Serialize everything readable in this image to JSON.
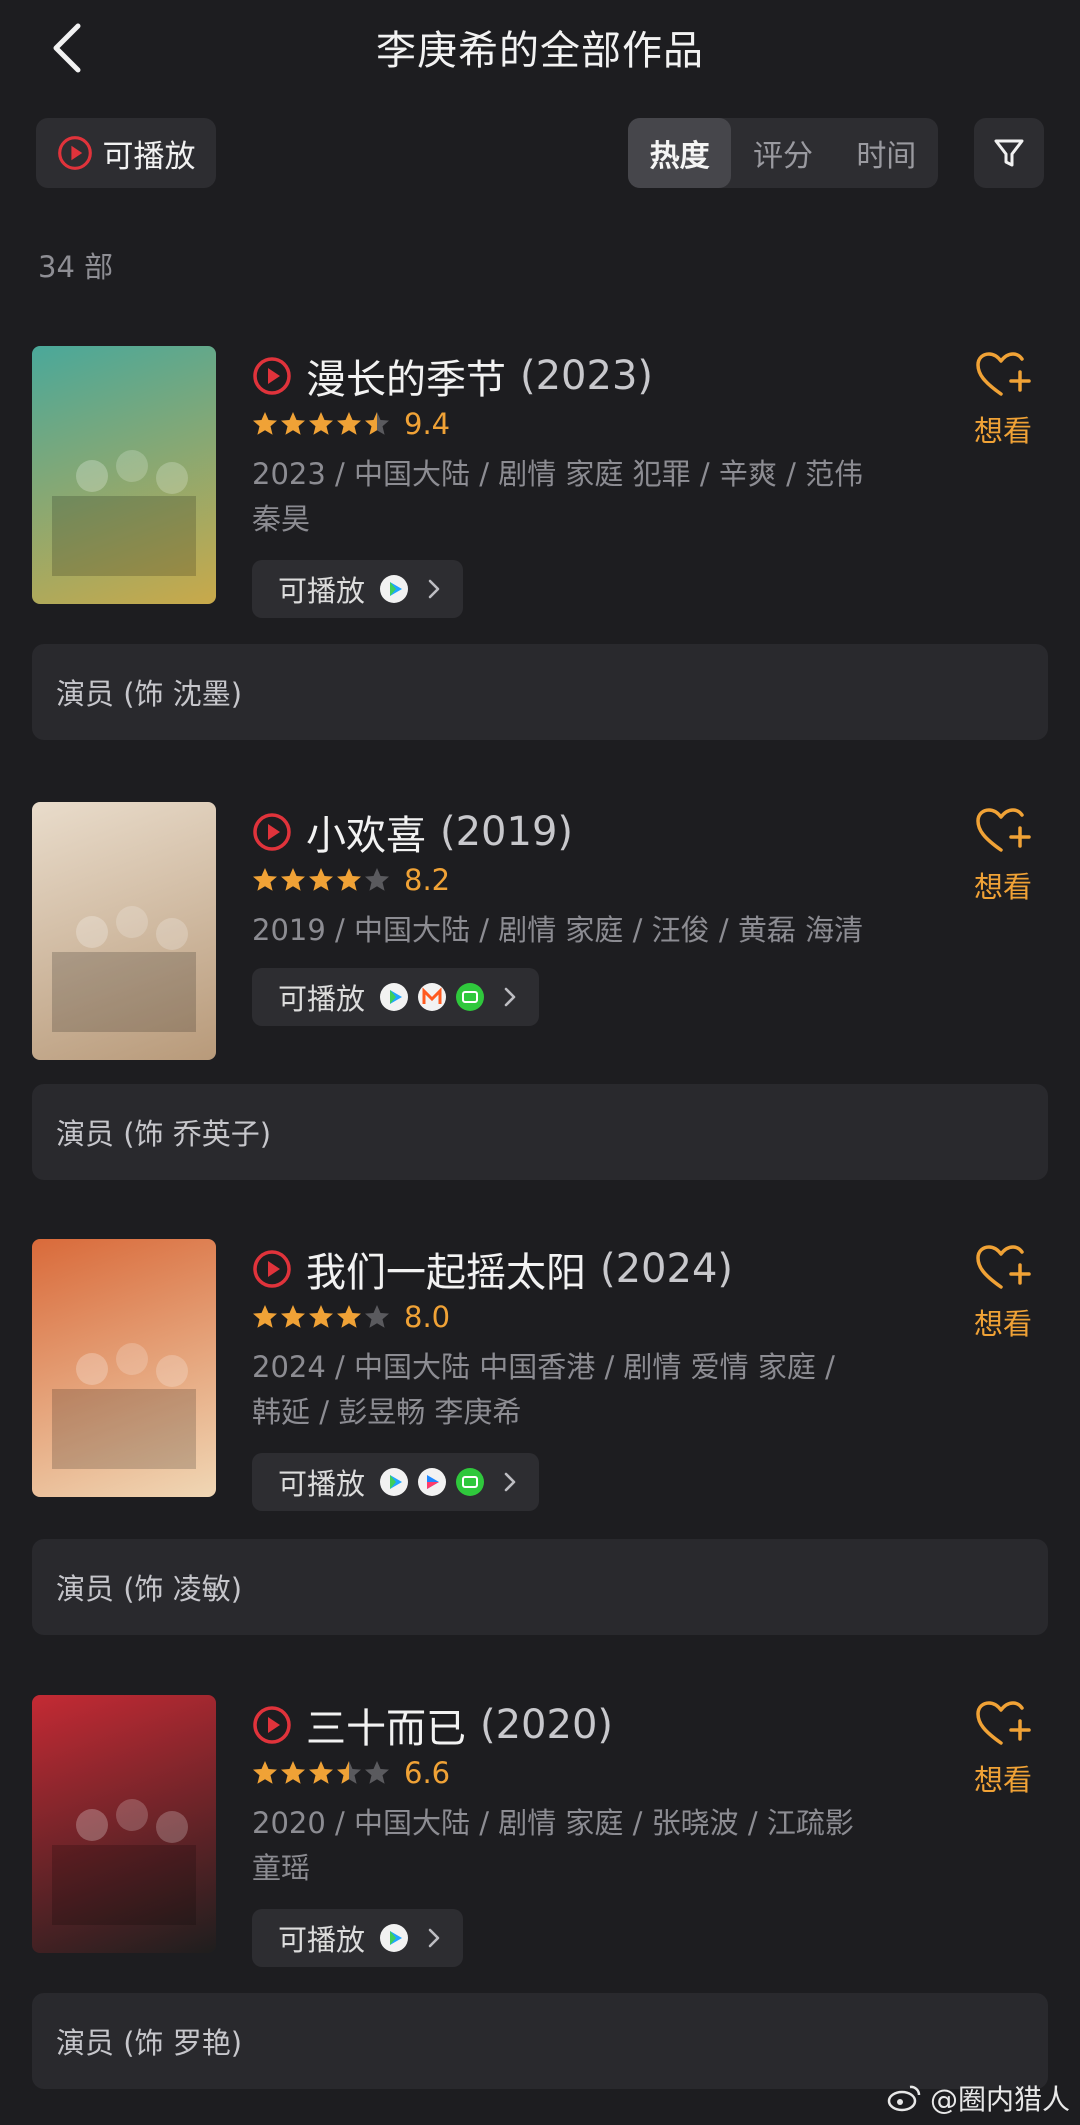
{
  "header": {
    "title": "李庚希的全部作品"
  },
  "toolbar": {
    "playable_label": "可播放",
    "sort_tabs": [
      {
        "label": "热度",
        "active": true
      },
      {
        "label": "评分",
        "active": false
      },
      {
        "label": "时间",
        "active": false
      }
    ]
  },
  "count_text": "34 部",
  "colors": {
    "accent": "#f0a236",
    "play_red": "#e0333b",
    "background": "#1d1d20",
    "card": "#29292d"
  },
  "works": [
    {
      "title": "漫长的季节",
      "year": "(2023)",
      "rating": 4.5,
      "score": "9.4",
      "meta_line1": "2023 / 中国大陆 / 剧情 家庭 犯罪 / 辛爽 / 范伟",
      "meta_line2": "秦昊",
      "available_label": "可播放",
      "sources": [
        "tencent-video-icon"
      ],
      "want_label": "想看",
      "role": "演员 (饰 沈墨)",
      "poster_colors": [
        "#4aa89a",
        "#c9a94a"
      ]
    },
    {
      "title": "小欢喜",
      "year": "(2019)",
      "rating": 4,
      "score": "8.2",
      "meta_line1": "2019 / 中国大陆 / 剧情 家庭 / 汪俊 / 黄磊 海清",
      "meta_line2": "",
      "available_label": "可播放",
      "sources": [
        "tencent-video-icon",
        "mango-tv-icon",
        "iqiyi-icon"
      ],
      "want_label": "想看",
      "role": "演员 (饰 乔英子)",
      "poster_colors": [
        "#e9dccb",
        "#b89a7a"
      ]
    },
    {
      "title": "我们一起摇太阳",
      "year": "(2024)",
      "rating": 4,
      "score": "8.0",
      "meta_line1": "2024 / 中国大陆 中国香港 / 剧情 爱情 家庭 /",
      "meta_line2": "韩延 / 彭昱畅 李庚希",
      "available_label": "可播放",
      "sources": [
        "tencent-video-icon",
        "youku-icon",
        "iqiyi-icon"
      ],
      "want_label": "想看",
      "role": "演员 (饰 凌敏)",
      "poster_colors": [
        "#d96a3a",
        "#f0d7b5"
      ]
    },
    {
      "title": "三十而已",
      "year": "(2020)",
      "rating": 3.5,
      "score": "6.6",
      "meta_line1": "2020 / 中国大陆 / 剧情 家庭 / 张晓波 / 江疏影",
      "meta_line2": "童瑶",
      "available_label": "可播放",
      "sources": [
        "tencent-video-icon"
      ],
      "want_label": "想看",
      "role": "演员 (饰 罗艳)",
      "poster_colors": [
        "#c42a34",
        "#1e1e1e"
      ]
    }
  ],
  "watermark": "@圈内猎人"
}
